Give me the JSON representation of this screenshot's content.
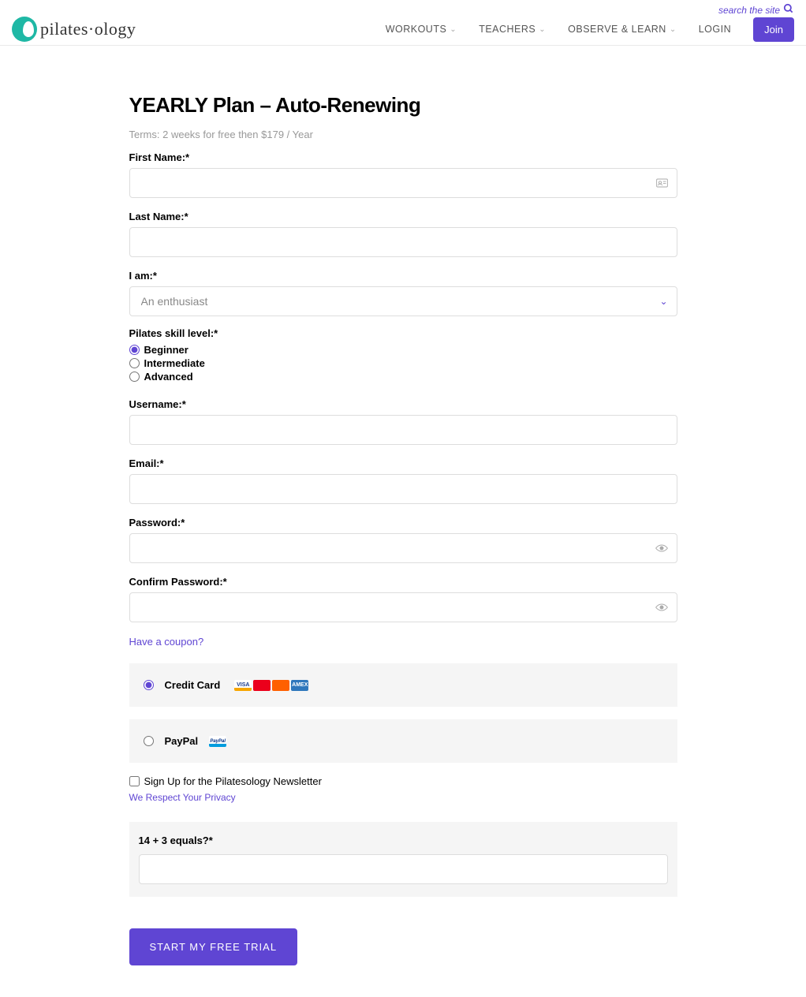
{
  "header": {
    "search_text": "search the site",
    "logo_text": "pilates·ology",
    "nav": {
      "workouts": "WORKOUTS",
      "teachers": "TEACHERS",
      "observe": "OBSERVE & LEARN",
      "login": "LOGIN",
      "join": "Join"
    }
  },
  "page": {
    "title": "YEARLY Plan – Auto-Renewing",
    "terms": "Terms: 2 weeks for free then $179 / Year"
  },
  "form": {
    "first_name_label": "First Name:*",
    "last_name_label": "Last Name:*",
    "iam_label": "I am:*",
    "iam_selected": "An enthusiast",
    "skill_label": "Pilates skill level:*",
    "skill_options": {
      "beginner": "Beginner",
      "intermediate": "Intermediate",
      "advanced": "Advanced"
    },
    "username_label": "Username:*",
    "email_label": "Email:*",
    "password_label": "Password:*",
    "confirm_password_label": "Confirm Password:*",
    "coupon_link": "Have a coupon?",
    "payment": {
      "credit_card": "Credit Card",
      "paypal": "PayPal",
      "visa": "VISA",
      "amex": "AMEX",
      "paypal_badge": "PayPal"
    },
    "newsletter_label": "Sign Up for the Pilatesology Newsletter",
    "privacy_link": "We Respect Your Privacy",
    "captcha_label": "14 + 3 equals?*",
    "submit": "START MY FREE TRIAL"
  }
}
